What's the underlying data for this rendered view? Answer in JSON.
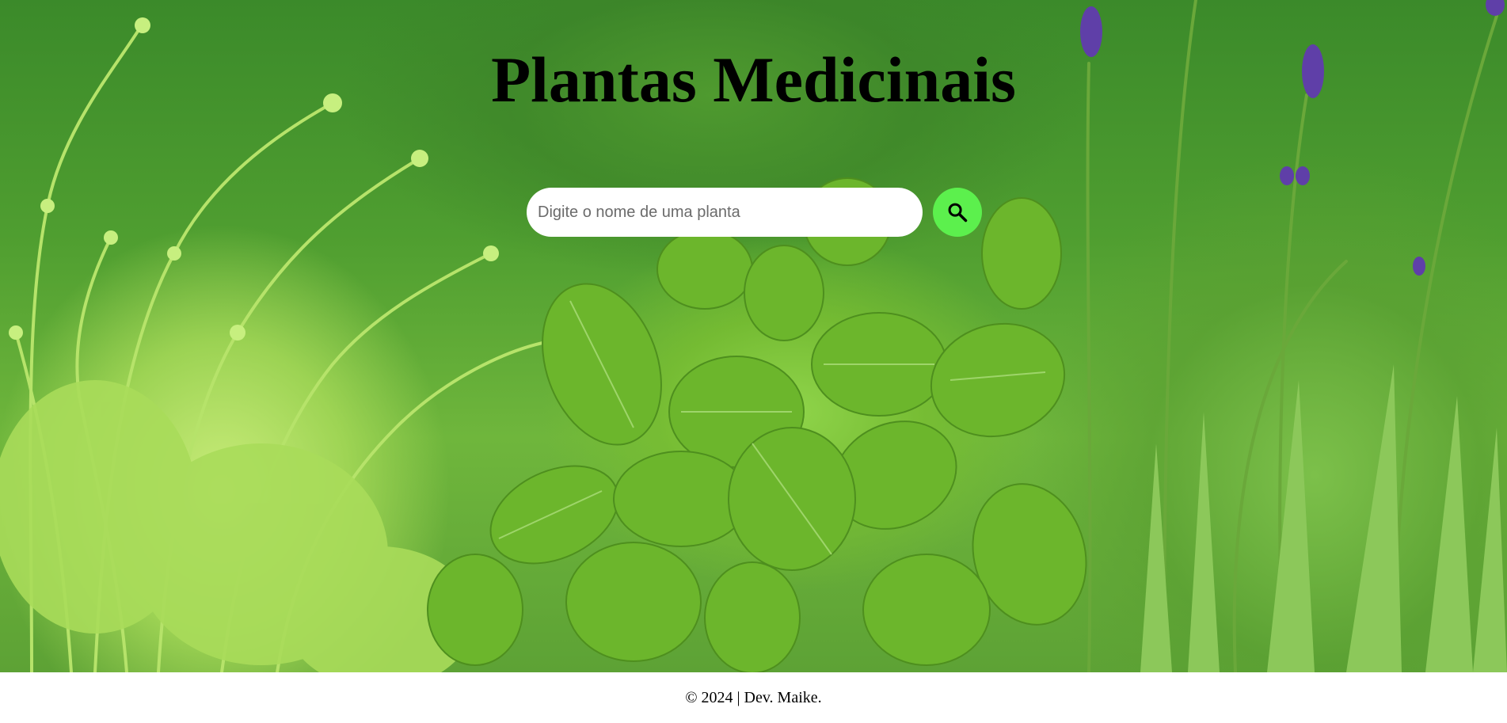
{
  "header": {
    "title": "Plantas Medicinais"
  },
  "search": {
    "placeholder": "Digite o nome de uma planta",
    "value": "",
    "button_icon": "search-icon",
    "button_color": "#5cf04d"
  },
  "footer": {
    "text": "© 2024 | Dev. Maike."
  }
}
